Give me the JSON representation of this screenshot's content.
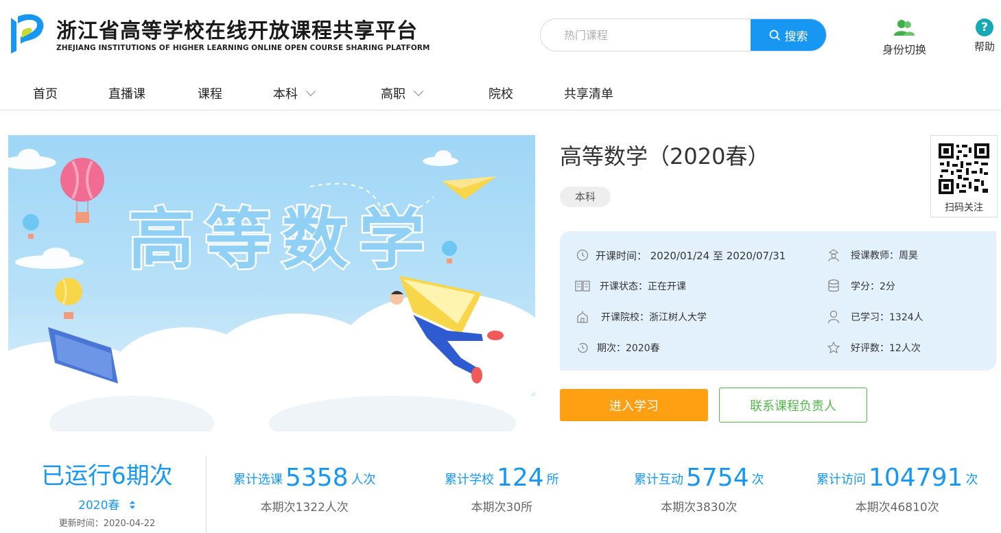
{
  "header": {
    "title": "浙江省高等学校在线开放课程共享平台",
    "subtitle": "ZHEJIANG INSTITUTIONS OF HIGHER LEARNING ONLINE OPEN COURSE SHARING PLATFORM",
    "search_placeholder": "热门课程",
    "search_button": "搜索",
    "switch_role": "身份切换",
    "help": "帮助"
  },
  "nav": {
    "items": [
      {
        "label": "首页"
      },
      {
        "label": "直播课"
      },
      {
        "label": "课程"
      },
      {
        "label": "本科"
      },
      {
        "label": "高职"
      },
      {
        "label": "院校"
      },
      {
        "label": "共享清单"
      }
    ]
  },
  "banner": {
    "text": "高等数学"
  },
  "course": {
    "title": "高等数学（2020春）",
    "tag": "本科",
    "qr_label": "扫码关注",
    "info": {
      "start_time": "开课时间：  2020/01/24 至 2020/07/31",
      "teacher": "授课教师：周昊",
      "status": "开课状态：正在开课",
      "credit": "学分：2分",
      "school": "开课院校：浙江树人大学",
      "learners": "已学习：1324人",
      "term": "期次：2020春",
      "rating": "好评数：12人次"
    },
    "enter_button": "进入学习",
    "contact_button": "联系课程负责人"
  },
  "stats": {
    "run_title": "已运行6期次",
    "term_select": "2020春",
    "updated": "更新时间：2020-04-22",
    "items": [
      {
        "prefix": "累计选课",
        "value": "5358",
        "unit": "人次",
        "sub": "本期次1322人次"
      },
      {
        "prefix": "累计学校",
        "value": "124",
        "unit": "所",
        "sub": "本期次30所"
      },
      {
        "prefix": "累计互动",
        "value": "5754",
        "unit": "次",
        "sub": "本期次3830次"
      },
      {
        "prefix": "累计访问",
        "value": "104791",
        "unit": "次",
        "sub": "本期次46810次"
      }
    ]
  },
  "colors": {
    "primary_blue": "#1897f2",
    "orange": "#ffa012",
    "green": "#52b84b"
  }
}
